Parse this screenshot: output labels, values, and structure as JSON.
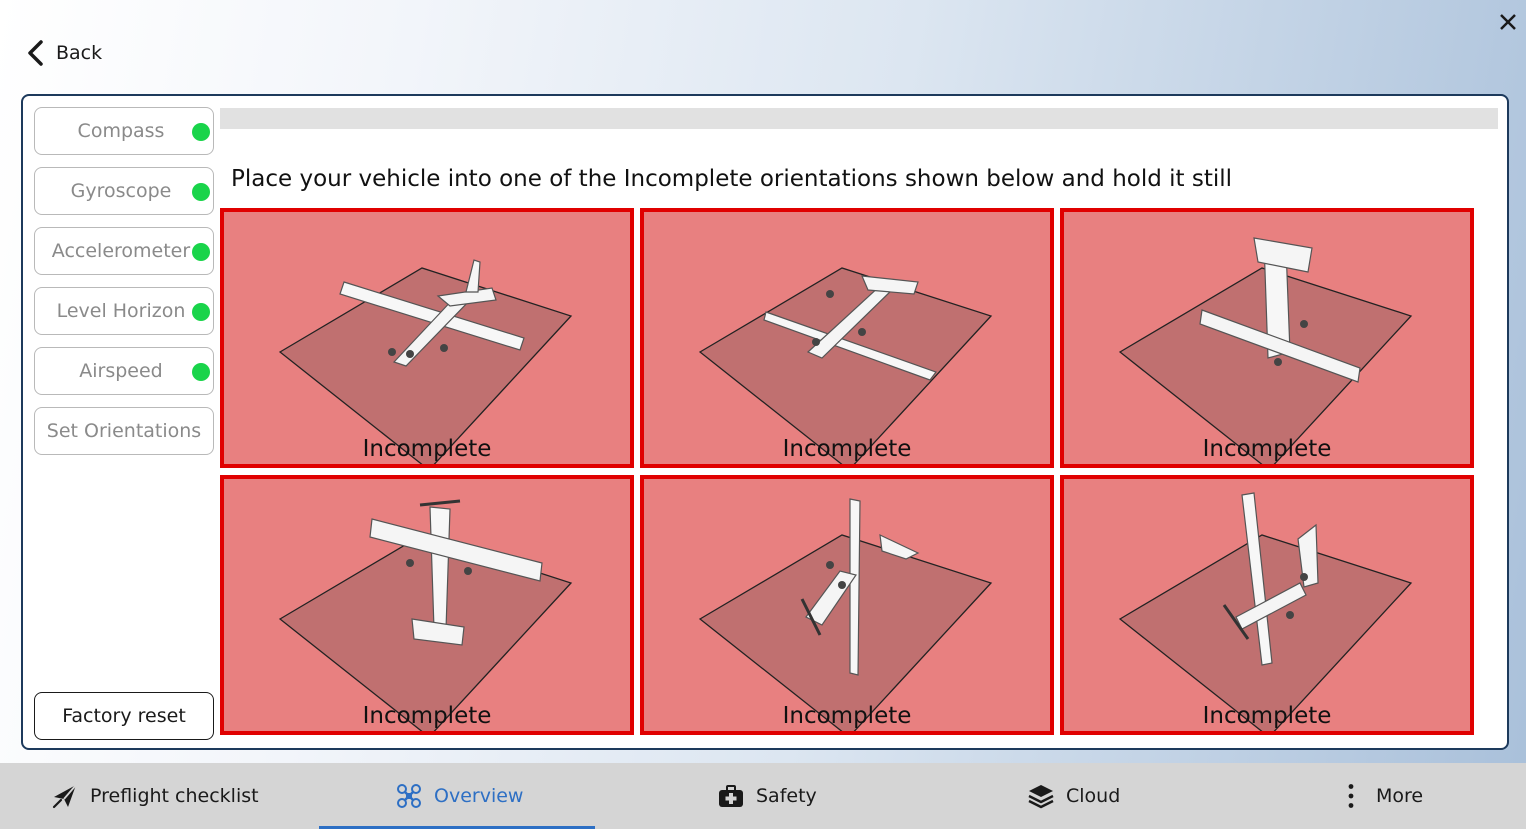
{
  "header": {
    "back_label": "Back"
  },
  "sensors": {
    "items": [
      {
        "label": "Compass",
        "status": "complete"
      },
      {
        "label": "Gyroscope",
        "status": "complete"
      },
      {
        "label": "Accelerometer",
        "status": "complete"
      },
      {
        "label": "Level Horizon",
        "status": "complete"
      },
      {
        "label": "Airspeed",
        "status": "complete"
      },
      {
        "label": "Set Orientations"
      }
    ],
    "factory_reset_label": "Factory reset",
    "status_color": "#19d44a"
  },
  "calibration": {
    "progress_percent": 0,
    "instruction": "Place your vehicle into one of the Incomplete orientations shown below and hold it still",
    "tile_color": "#e88080",
    "tile_border_color": "#e00000",
    "orientations": [
      {
        "label": "Incomplete",
        "pose": "upright"
      },
      {
        "label": "Incomplete",
        "pose": "inverted"
      },
      {
        "label": "Incomplete",
        "pose": "nose-down"
      },
      {
        "label": "Incomplete",
        "pose": "tail-down"
      },
      {
        "label": "Incomplete",
        "pose": "left-side"
      },
      {
        "label": "Incomplete",
        "pose": "right-side"
      }
    ]
  },
  "navbar": {
    "items": [
      {
        "label": "Preflight checklist",
        "icon": "paper-plane-icon"
      },
      {
        "label": "Overview",
        "icon": "drone-icon",
        "active": true
      },
      {
        "label": "Safety",
        "icon": "first-aid-kit-icon"
      },
      {
        "label": "Cloud",
        "icon": "layers-icon"
      },
      {
        "label": "More",
        "icon": "vertical-dots-icon"
      }
    ],
    "active_color": "#2d6fc4"
  }
}
